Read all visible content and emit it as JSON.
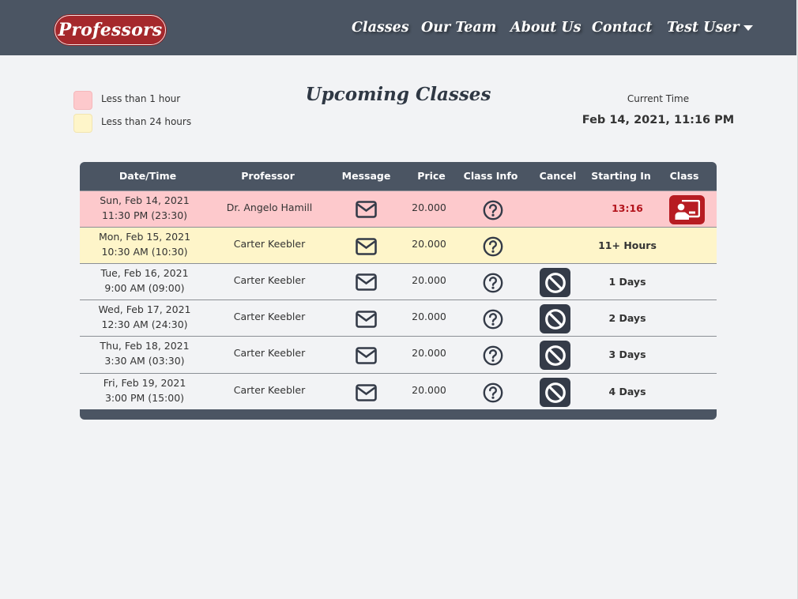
{
  "brand": {
    "label": "Professors"
  },
  "nav": {
    "classes": "Classes",
    "team": "Our Team",
    "about": "About Us",
    "contact": "Contact",
    "user": "Test User"
  },
  "legend": {
    "hour": {
      "label": "Less than 1 hour",
      "color": "#fdc9cc"
    },
    "day": {
      "label": "Less than 24 hours",
      "color": "#fef5c9"
    }
  },
  "page_title": "Upcoming Classes",
  "current_time": {
    "label": "Current Time",
    "value": "Feb 14, 2021, 11:16 PM"
  },
  "table": {
    "headers": {
      "datetime": "Date/Time",
      "professor": "Professor",
      "message": "Message",
      "price": "Price",
      "info": "Class Info",
      "cancel": "Cancel",
      "starting": "Starting In",
      "class": "Class"
    },
    "rows": [
      {
        "date": "Sun, Feb 14, 2021",
        "time": "11:30 PM (23:30)",
        "professor": "Dr. Angelo Hamill",
        "price": "20.000",
        "starting": "13:16"
      },
      {
        "date": "Mon, Feb 15, 2021",
        "time": "10:30 AM (10:30)",
        "professor": "Carter Keebler",
        "price": "20.000",
        "starting": "11+ Hours"
      },
      {
        "date": "Tue, Feb 16, 2021",
        "time": "9:00 AM (09:00)",
        "professor": "Carter Keebler",
        "price": "20.000",
        "starting": "1 Days"
      },
      {
        "date": "Wed, Feb 17, 2021",
        "time": "12:30 AM (24:30)",
        "professor": "Carter Keebler",
        "price": "20.000",
        "starting": "2 Days"
      },
      {
        "date": "Thu, Feb 18, 2021",
        "time": "3:30 AM (03:30)",
        "professor": "Carter Keebler",
        "price": "20.000",
        "starting": "3 Days"
      },
      {
        "date": "Fri, Feb 19, 2021",
        "time": "3:00 PM (15:00)",
        "professor": "Carter Keebler",
        "price": "20.000",
        "starting": "4 Days"
      }
    ]
  },
  "colors": {
    "navbar": "#4b5563",
    "brand_red": "#a5282c",
    "urgent_row": "#fdc9cc",
    "soon_row": "#fef5c9",
    "cancel_button": "#343b48",
    "join_button": "#b71c22"
  },
  "icons": {
    "message": "envelope-icon",
    "info": "question-circle-icon",
    "cancel": "ban-icon",
    "join": "chalkboard-teacher-icon",
    "user_menu": "caret-down-icon"
  }
}
